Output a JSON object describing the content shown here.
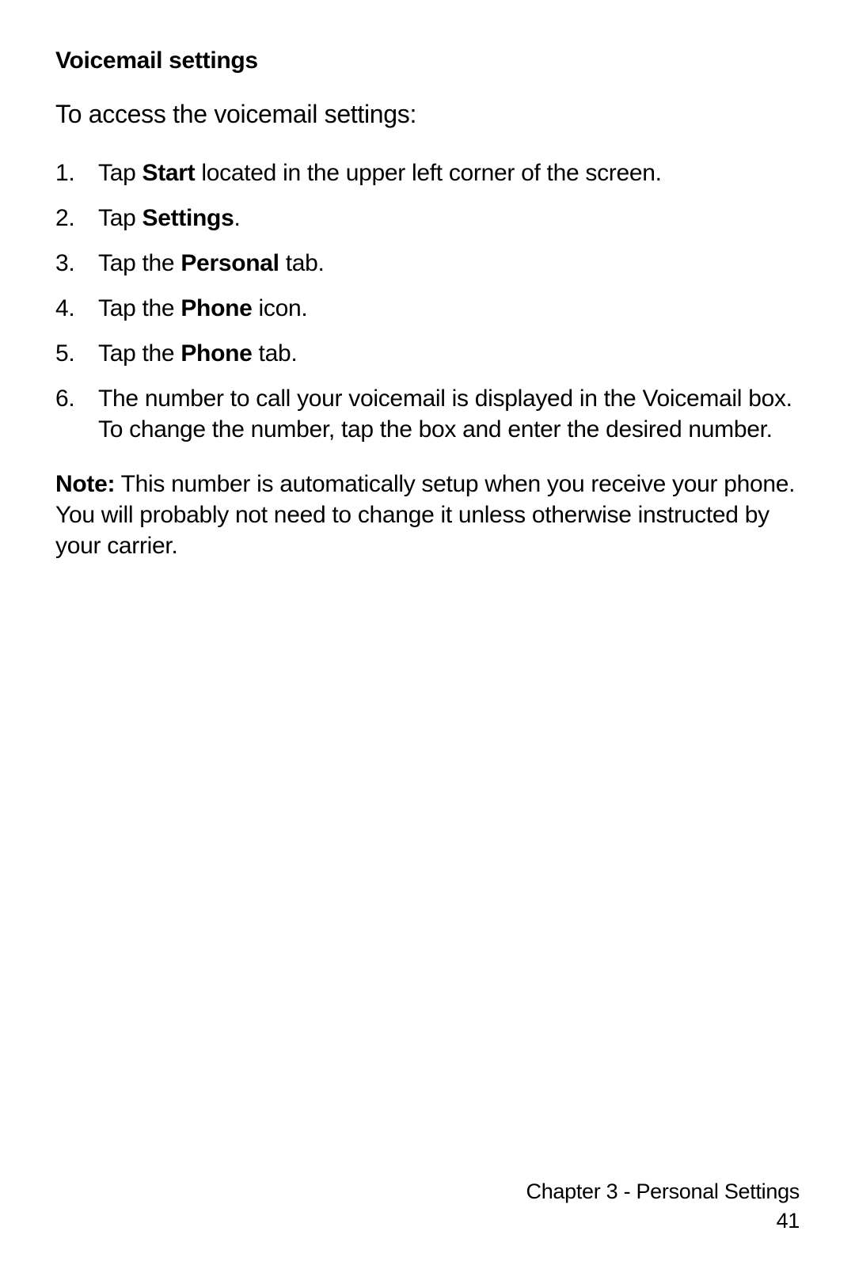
{
  "heading": "Voicemail settings",
  "intro": "To access the voicemail settings:",
  "steps": {
    "s1_pre": "Tap ",
    "s1_bold": "Start",
    "s1_post": " located in the upper left corner of the screen.",
    "s2_pre": "Tap ",
    "s2_bold": "Settings",
    "s2_post": ".",
    "s3_pre": "Tap the ",
    "s3_bold": "Personal",
    "s3_post": " tab.",
    "s4_pre": "Tap the ",
    "s4_bold": "Phone",
    "s4_post": " icon.",
    "s5_pre": "Tap the ",
    "s5_bold": "Phone",
    "s5_post": " tab.",
    "s6": "The number to call your voicemail is displayed in the Voicemail box. To change the number, tap the box and enter the desired number."
  },
  "note_label": "Note:",
  "note_text": " This number is automatically setup when you receive your phone. You will probably not need to change it unless otherwise instructed by your carrier.",
  "footer_chapter": "Chapter 3 - Personal Settings",
  "footer_page": "41"
}
